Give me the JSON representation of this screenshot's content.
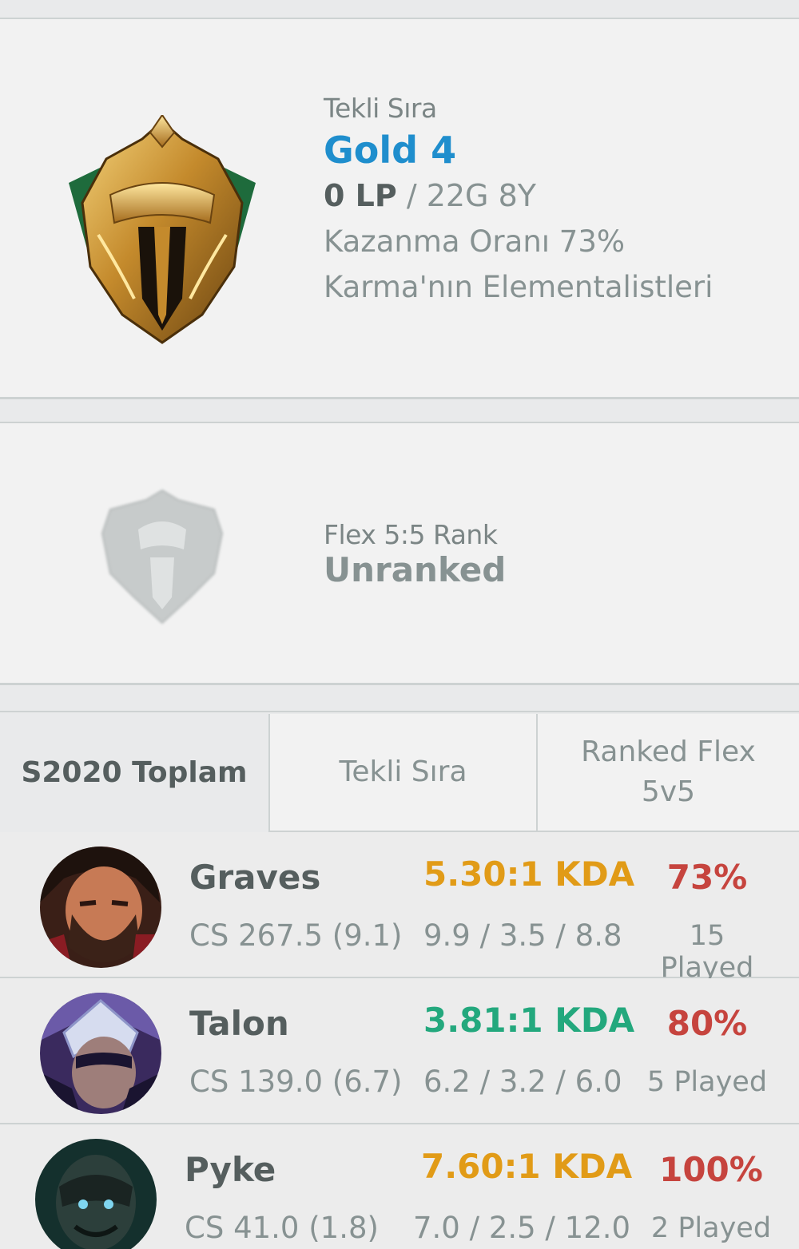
{
  "solo_rank": {
    "queue_label": "Tekli Sıra",
    "tier": "Gold 4",
    "lp": "0 LP",
    "record": " / 22G 8Y",
    "win_rate": "Kazanma Oranı 73%",
    "league_name": "Karma'nın Elementalistleri",
    "emblem_icon": "gold-emblem-icon"
  },
  "flex_rank": {
    "queue_label": "Flex 5:5 Rank",
    "tier": "Unranked",
    "emblem_icon": "unranked-emblem-icon"
  },
  "tabs": [
    {
      "label": "S2020 Toplam",
      "active": true
    },
    {
      "label": "Tekli Sıra",
      "active": false
    },
    {
      "label": "Ranked Flex\n5v5",
      "active": false
    }
  ],
  "colors": {
    "tier_gold": "#1f8ecd",
    "kda_orange": "#e19b17",
    "kda_green": "#23a87d",
    "winrate_red": "#c6443e"
  },
  "champions": [
    {
      "name": "Graves",
      "cs": "CS 267.5 (9.1)",
      "kda": "5.30:1 KDA",
      "kda_color": "#e19b17",
      "kda_detail": "9.9 / 3.5 / 8.8",
      "win_rate": "73%",
      "played": "15 Played"
    },
    {
      "name": "Talon",
      "cs": "CS 139.0 (6.7)",
      "kda": "3.81:1 KDA",
      "kda_color": "#23a87d",
      "kda_detail": "6.2 / 3.2 / 6.0",
      "win_rate": "80%",
      "played": "5 Played"
    },
    {
      "name": "Pyke",
      "cs": "CS 41.0 (1.8)",
      "kda": "7.60:1 KDA",
      "kda_color": "#e19b17",
      "kda_detail": "7.0 / 2.5 / 12.0",
      "win_rate": "100%",
      "played": "2 Played"
    }
  ]
}
